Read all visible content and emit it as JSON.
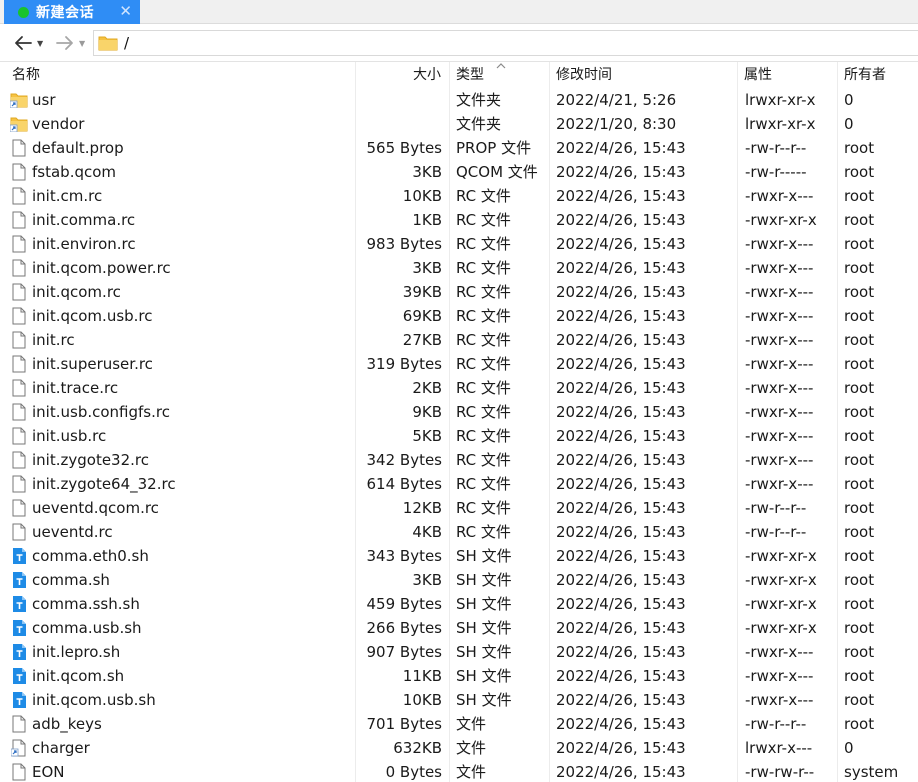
{
  "tab": {
    "title": "新建会话",
    "close": "✕"
  },
  "toolbar": {
    "path": "/"
  },
  "columns": [
    "名称",
    "大小",
    "类型",
    "修改时间",
    "属性",
    "所有者"
  ],
  "colors": {
    "tab_bg": "#2f8df5",
    "status_dot": "#19c32d",
    "folder": "#f6c242",
    "shell_icon": "#1e8be6"
  },
  "files": [
    {
      "name": "usr",
      "size": "",
      "type": "文件夹",
      "time": "2022/4/21, 5:26",
      "attr": "lrwxr-xr-x",
      "owner": "0",
      "icon": "folder-link"
    },
    {
      "name": "vendor",
      "size": "",
      "type": "文件夹",
      "time": "2022/1/20, 8:30",
      "attr": "lrwxr-xr-x",
      "owner": "0",
      "icon": "folder-link"
    },
    {
      "name": "default.prop",
      "size": "565 Bytes",
      "type": "PROP 文件",
      "time": "2022/4/26, 15:43",
      "attr": "-rw-r--r--",
      "owner": "root",
      "icon": "file"
    },
    {
      "name": "fstab.qcom",
      "size": "3KB",
      "type": "QCOM 文件",
      "time": "2022/4/26, 15:43",
      "attr": "-rw-r-----",
      "owner": "root",
      "icon": "file"
    },
    {
      "name": "init.cm.rc",
      "size": "10KB",
      "type": "RC 文件",
      "time": "2022/4/26, 15:43",
      "attr": "-rwxr-x---",
      "owner": "root",
      "icon": "file"
    },
    {
      "name": "init.comma.rc",
      "size": "1KB",
      "type": "RC 文件",
      "time": "2022/4/26, 15:43",
      "attr": "-rwxr-xr-x",
      "owner": "root",
      "icon": "file"
    },
    {
      "name": "init.environ.rc",
      "size": "983 Bytes",
      "type": "RC 文件",
      "time": "2022/4/26, 15:43",
      "attr": "-rwxr-x---",
      "owner": "root",
      "icon": "file"
    },
    {
      "name": "init.qcom.power.rc",
      "size": "3KB",
      "type": "RC 文件",
      "time": "2022/4/26, 15:43",
      "attr": "-rwxr-x---",
      "owner": "root",
      "icon": "file"
    },
    {
      "name": "init.qcom.rc",
      "size": "39KB",
      "type": "RC 文件",
      "time": "2022/4/26, 15:43",
      "attr": "-rwxr-x---",
      "owner": "root",
      "icon": "file"
    },
    {
      "name": "init.qcom.usb.rc",
      "size": "69KB",
      "type": "RC 文件",
      "time": "2022/4/26, 15:43",
      "attr": "-rwxr-x---",
      "owner": "root",
      "icon": "file"
    },
    {
      "name": "init.rc",
      "size": "27KB",
      "type": "RC 文件",
      "time": "2022/4/26, 15:43",
      "attr": "-rwxr-x---",
      "owner": "root",
      "icon": "file"
    },
    {
      "name": "init.superuser.rc",
      "size": "319 Bytes",
      "type": "RC 文件",
      "time": "2022/4/26, 15:43",
      "attr": "-rwxr-x---",
      "owner": "root",
      "icon": "file"
    },
    {
      "name": "init.trace.rc",
      "size": "2KB",
      "type": "RC 文件",
      "time": "2022/4/26, 15:43",
      "attr": "-rwxr-x---",
      "owner": "root",
      "icon": "file"
    },
    {
      "name": "init.usb.configfs.rc",
      "size": "9KB",
      "type": "RC 文件",
      "time": "2022/4/26, 15:43",
      "attr": "-rwxr-x---",
      "owner": "root",
      "icon": "file"
    },
    {
      "name": "init.usb.rc",
      "size": "5KB",
      "type": "RC 文件",
      "time": "2022/4/26, 15:43",
      "attr": "-rwxr-x---",
      "owner": "root",
      "icon": "file"
    },
    {
      "name": "init.zygote32.rc",
      "size": "342 Bytes",
      "type": "RC 文件",
      "time": "2022/4/26, 15:43",
      "attr": "-rwxr-x---",
      "owner": "root",
      "icon": "file"
    },
    {
      "name": "init.zygote64_32.rc",
      "size": "614 Bytes",
      "type": "RC 文件",
      "time": "2022/4/26, 15:43",
      "attr": "-rwxr-x---",
      "owner": "root",
      "icon": "file"
    },
    {
      "name": "ueventd.qcom.rc",
      "size": "12KB",
      "type": "RC 文件",
      "time": "2022/4/26, 15:43",
      "attr": "-rw-r--r--",
      "owner": "root",
      "icon": "file"
    },
    {
      "name": "ueventd.rc",
      "size": "4KB",
      "type": "RC 文件",
      "time": "2022/4/26, 15:43",
      "attr": "-rw-r--r--",
      "owner": "root",
      "icon": "file"
    },
    {
      "name": "comma.eth0.sh",
      "size": "343 Bytes",
      "type": "SH 文件",
      "time": "2022/4/26, 15:43",
      "attr": "-rwxr-xr-x",
      "owner": "root",
      "icon": "shell"
    },
    {
      "name": "comma.sh",
      "size": "3KB",
      "type": "SH 文件",
      "time": "2022/4/26, 15:43",
      "attr": "-rwxr-xr-x",
      "owner": "root",
      "icon": "shell"
    },
    {
      "name": "comma.ssh.sh",
      "size": "459 Bytes",
      "type": "SH 文件",
      "time": "2022/4/26, 15:43",
      "attr": "-rwxr-xr-x",
      "owner": "root",
      "icon": "shell"
    },
    {
      "name": "comma.usb.sh",
      "size": "266 Bytes",
      "type": "SH 文件",
      "time": "2022/4/26, 15:43",
      "attr": "-rwxr-xr-x",
      "owner": "root",
      "icon": "shell"
    },
    {
      "name": "init.lepro.sh",
      "size": "907 Bytes",
      "type": "SH 文件",
      "time": "2022/4/26, 15:43",
      "attr": "-rwxr-x---",
      "owner": "root",
      "icon": "shell"
    },
    {
      "name": "init.qcom.sh",
      "size": "11KB",
      "type": "SH 文件",
      "time": "2022/4/26, 15:43",
      "attr": "-rwxr-x---",
      "owner": "root",
      "icon": "shell"
    },
    {
      "name": "init.qcom.usb.sh",
      "size": "10KB",
      "type": "SH 文件",
      "time": "2022/4/26, 15:43",
      "attr": "-rwxr-x---",
      "owner": "root",
      "icon": "shell"
    },
    {
      "name": "adb_keys",
      "size": "701 Bytes",
      "type": "文件",
      "time": "2022/4/26, 15:43",
      "attr": "-rw-r--r--",
      "owner": "root",
      "icon": "file"
    },
    {
      "name": "charger",
      "size": "632KB",
      "type": "文件",
      "time": "2022/4/26, 15:43",
      "attr": "lrwxr-x---",
      "owner": "0",
      "icon": "file-link"
    },
    {
      "name": "EON",
      "size": "0 Bytes",
      "type": "文件",
      "time": "2022/4/26, 15:43",
      "attr": "-rw-rw-r--",
      "owner": "system",
      "icon": "file"
    }
  ]
}
